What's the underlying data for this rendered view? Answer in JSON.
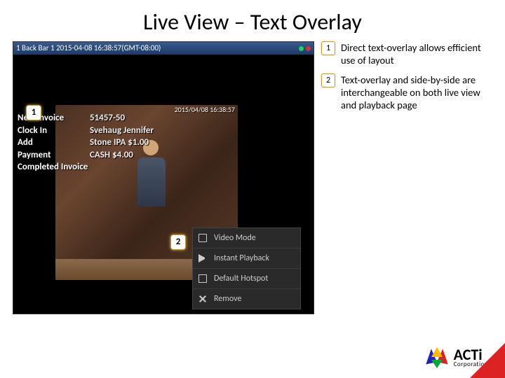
{
  "title": "Live View – Text Overlay",
  "video": {
    "header": "1 Back Bar 1  2015-04-08 16:38:57(GMT-08:00)",
    "scene_timestamp": "2015/04/08 16:38:57",
    "overlay": [
      {
        "l": "New Invoice",
        "v": "51457-50"
      },
      {
        "l": "Clock In",
        "v": "Svehaug Jennifer"
      },
      {
        "l": "Add",
        "v": "Stone IPA   $1.00"
      },
      {
        "l": "Payment",
        "v": "CASH   $4.00"
      },
      {
        "l": "Completed Invoice",
        "v": ""
      }
    ]
  },
  "context_menu": [
    "Video Mode",
    "Instant Playback",
    "Default Hotspot",
    "Remove"
  ],
  "callouts": {
    "c1": "1",
    "c2": "2"
  },
  "notes": [
    {
      "n": "1",
      "t": "Direct text-overlay allows efficient use of layout"
    },
    {
      "n": "2",
      "t": "Text-overlay and side-by-side are interchangeable on both live view and playback page"
    }
  ],
  "logo": {
    "name": "ACTi",
    "sub": "Corporation"
  }
}
